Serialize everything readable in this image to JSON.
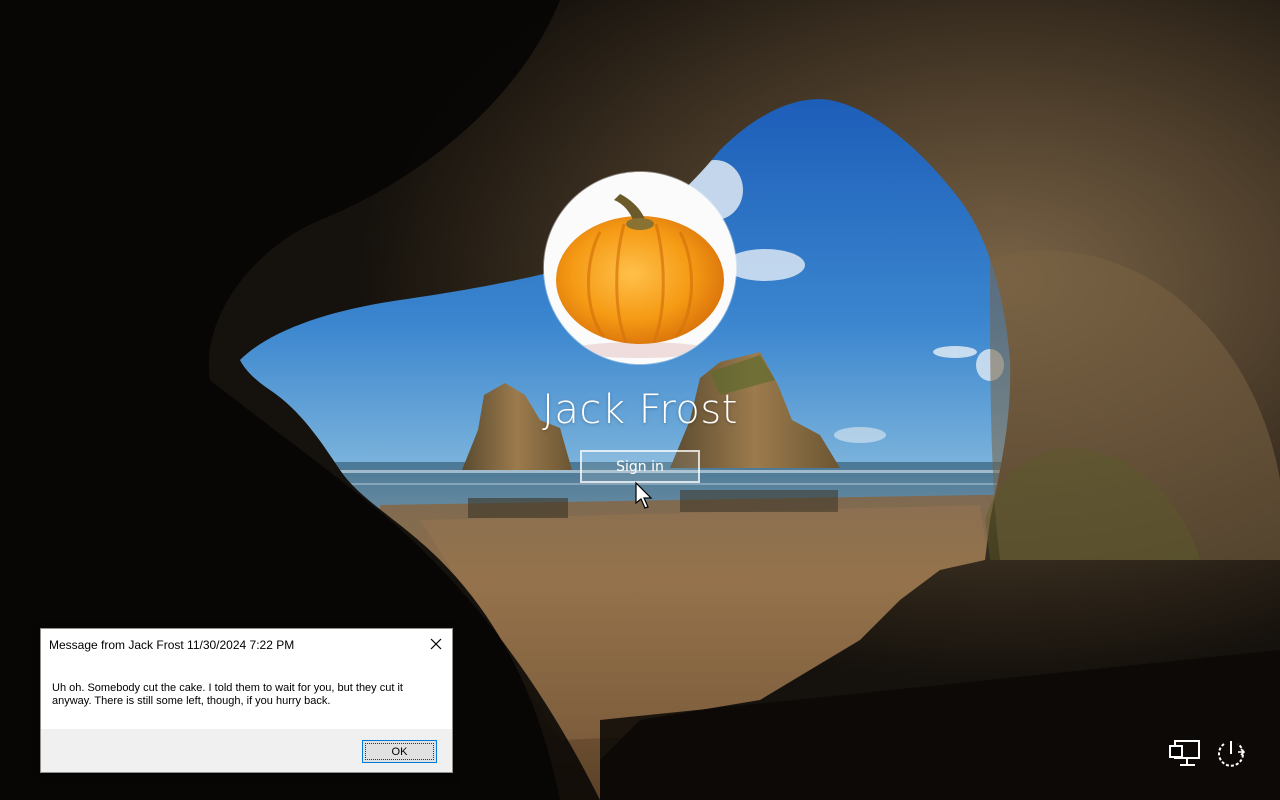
{
  "login": {
    "username": "Jack Frost",
    "sign_in_label": "Sign in",
    "avatar_icon": "pumpkin-avatar"
  },
  "dialog": {
    "title": "Message from Jack Frost 11/30/2024 7:22 PM",
    "message": "Uh oh. Somebody cut the cake. I told them to wait for you, but they cut it anyway. There is still some left, though, if you hurry back.",
    "ok_label": "OK",
    "close_icon": "close-icon"
  },
  "system_icons": [
    "network-icon",
    "power-icon"
  ],
  "colors": {
    "sky": "#2f74c4",
    "sea": "#3c6a8e",
    "sand": "#8a6a45",
    "cave": "#1a1510",
    "dialog_footer": "#f0f0f0",
    "button_focus": "#0078d7"
  }
}
